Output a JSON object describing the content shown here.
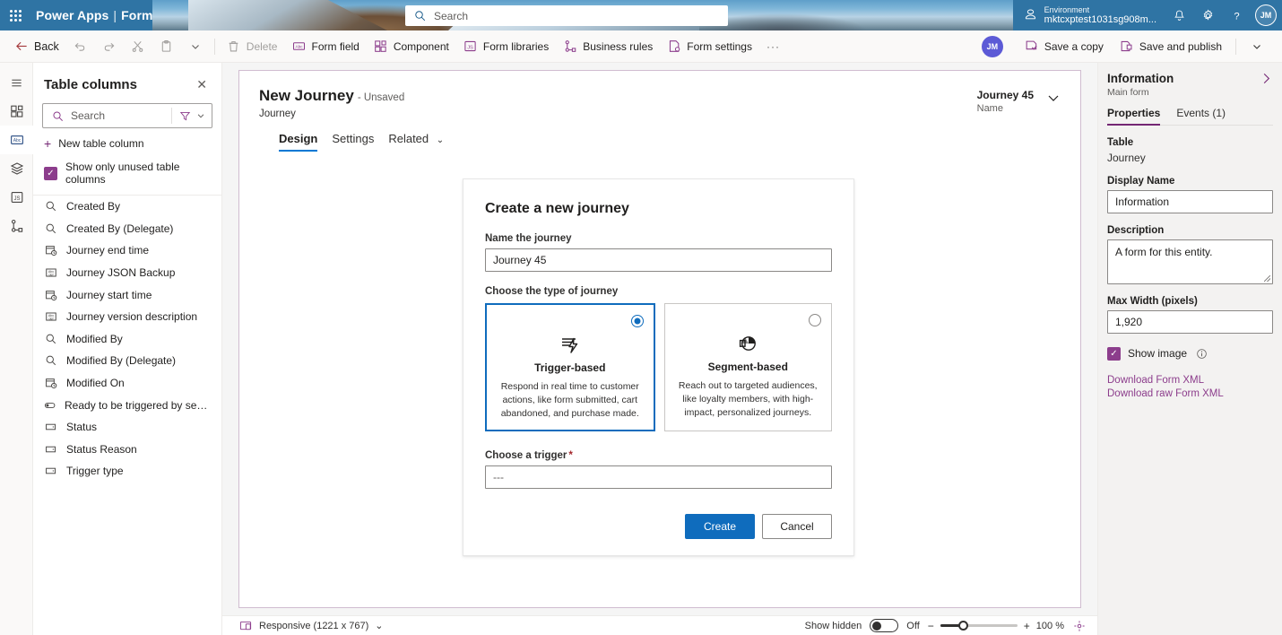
{
  "suitebar": {
    "waffle": "app-launcher",
    "brand_app": "Power Apps",
    "brand_sep": "|",
    "brand_area": "Form",
    "search_placeholder": "Search",
    "environment_label": "Environment",
    "environment_value": "mktcxptest1031sg908m...",
    "avatar_initials": "JM",
    "bg_color": "#2f74a4"
  },
  "commandbar": {
    "back": "Back",
    "undo": "undo",
    "redo": "redo",
    "cut": "cut",
    "paste": "paste",
    "more_chevron": "chevron-down",
    "delete": "Delete",
    "form_field": "Form field",
    "component": "Component",
    "form_libraries": "Form libraries",
    "business_rules": "Business rules",
    "form_settings": "Form settings",
    "overflow": "···",
    "avatar_initials": "JM",
    "save_a_copy": "Save a copy",
    "save_and_publish": "Save and publish",
    "split_chevron": "chevron-down"
  },
  "rail": {
    "items": [
      {
        "name": "menu",
        "glyph": "☰"
      },
      {
        "name": "components",
        "glyph": "components"
      },
      {
        "name": "table-columns",
        "glyph": "abc"
      },
      {
        "name": "data-sources",
        "glyph": "layers"
      },
      {
        "name": "form-libraries",
        "glyph": "js"
      },
      {
        "name": "business-rules",
        "glyph": "rules"
      }
    ]
  },
  "table_columns_panel": {
    "title": "Table columns",
    "close": "✕",
    "search_placeholder": "Search",
    "filter_icon": "filter-icon",
    "new_column": "New table column",
    "show_unused_label": "Show only unused table columns",
    "show_unused_checked": true,
    "columns": [
      {
        "label": "Created By",
        "icon": "lookup"
      },
      {
        "label": "Created By (Delegate)",
        "icon": "lookup"
      },
      {
        "label": "Journey end time",
        "icon": "datetime"
      },
      {
        "label": "Journey JSON Backup",
        "icon": "text"
      },
      {
        "label": "Journey start time",
        "icon": "datetime"
      },
      {
        "label": "Journey version description",
        "icon": "text"
      },
      {
        "label": "Modified By",
        "icon": "lookup"
      },
      {
        "label": "Modified By (Delegate)",
        "icon": "lookup"
      },
      {
        "label": "Modified On",
        "icon": "datetime"
      },
      {
        "label": "Ready to be triggered by segment r...",
        "icon": "toggle"
      },
      {
        "label": "Status",
        "icon": "choice"
      },
      {
        "label": "Status Reason",
        "icon": "choice"
      },
      {
        "label": "Trigger type",
        "icon": "choice"
      }
    ]
  },
  "form_canvas": {
    "title": "New Journey",
    "unsaved": "- Unsaved",
    "subtitle": "Journey",
    "record_value": "Journey 45",
    "record_label": "Name",
    "chevron": "chevron-down",
    "tabs": [
      {
        "label": "Design",
        "active": true,
        "chevron": ""
      },
      {
        "label": "Settings",
        "active": false,
        "chevron": ""
      },
      {
        "label": "Related",
        "active": false,
        "chevron": "⌄"
      }
    ]
  },
  "dialog": {
    "title": "Create a new journey",
    "name_label": "Name the journey",
    "name_value": "Journey 45",
    "type_label": "Choose the type of journey",
    "options": [
      {
        "name": "Trigger-based",
        "description": "Respond in real time to customer actions, like form submitted, cart abandoned, and purchase made.",
        "selected": true,
        "icon": "trigger-icon"
      },
      {
        "name": "Segment-based",
        "description": "Reach out to targeted audiences, like loyalty members, with high-impact, personalized journeys.",
        "selected": false,
        "icon": "segment-pie-icon"
      }
    ],
    "trigger_label": "Choose a trigger",
    "trigger_required": "*",
    "trigger_value": "---",
    "create_button": "Create",
    "cancel_button": "Cancel",
    "accent_color": "#0f6cbd"
  },
  "properties_panel": {
    "title": "Information",
    "subtitle": "Main form",
    "expand_icon": "chevron-right",
    "tabs": [
      {
        "label": "Properties",
        "active": true
      },
      {
        "label": "Events (1)",
        "active": false
      }
    ],
    "table_label": "Table",
    "table_value": "Journey",
    "display_name_label": "Display Name",
    "display_name_value": "Information",
    "description_label": "Description",
    "description_value": "A form for this entity.",
    "max_width_label": "Max Width (pixels)",
    "max_width_value": "1,920",
    "show_image_label": "Show image",
    "show_image_checked": true,
    "info_icon": "info-icon",
    "links": [
      "Download Form XML",
      "Download raw Form XML"
    ],
    "link_color": "#8c3d8c"
  },
  "statusbar": {
    "responsive_icon": "responsive-icon",
    "responsive_label": "Responsive (1221 x 767)",
    "responsive_chevron": "⌄",
    "show_hidden_label": "Show hidden",
    "show_hidden_state": "Off",
    "zoom_minus": "−",
    "zoom_plus": "+",
    "zoom_level": "100 %",
    "fit_icon": "fit-to-screen-icon"
  }
}
